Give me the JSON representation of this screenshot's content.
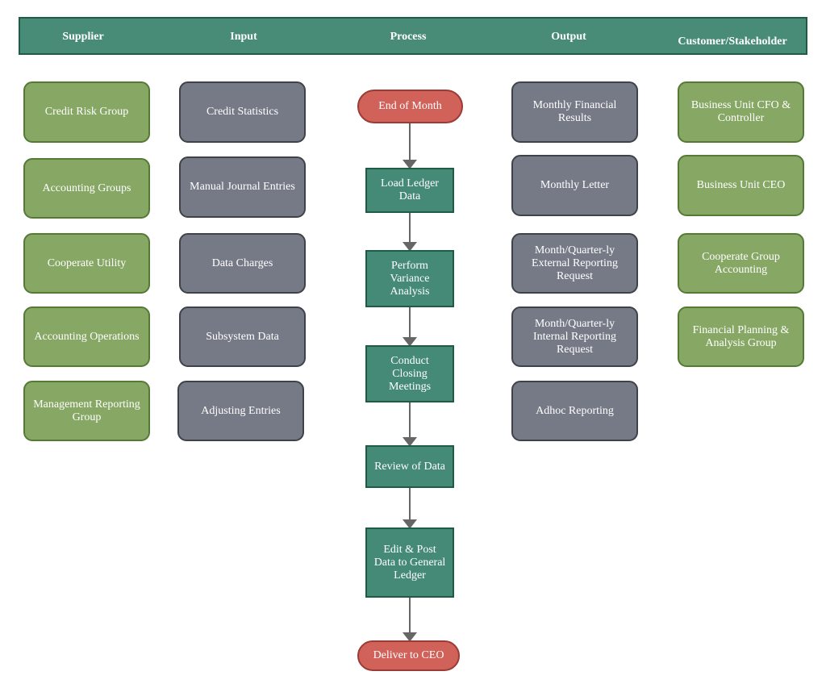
{
  "header": {
    "columns": [
      "Supplier",
      "Input",
      "Process",
      "Output",
      "Customer/Stakeholder"
    ]
  },
  "suppliers": [
    "Credit Risk Group",
    "Accounting Groups",
    "Cooperate Utility",
    "Accounting Operations",
    "Management Reporting Group"
  ],
  "inputs": [
    "Credit Statistics",
    "Manual Journal Entries",
    "Data Charges",
    "Subsystem Data",
    "Adjusting Entries"
  ],
  "process": {
    "start": "End of Month",
    "steps": [
      "Load Ledger Data",
      "Perform Variance Analysis",
      "Conduct Closing Meetings",
      "Review of Data",
      "Edit & Post Data to General Ledger"
    ],
    "end": "Deliver to CEO"
  },
  "outputs": [
    "Monthly Financial Results",
    "Monthly Letter",
    "Month/Quarter-ly External Reporting Request",
    "Month/Quarter-ly Internal Reporting Request",
    "Adhoc Reporting"
  ],
  "customers": [
    "Business Unit CFO & Controller",
    "Business Unit CEO",
    "Cooperate Group Accounting",
    "Financial Planning & Analysis Group"
  ],
  "colors": {
    "header": "#488c78",
    "supplier_customer": "#87a765",
    "input_output": "#767a86",
    "process_step": "#458a77",
    "terminal": "#d1625a",
    "connector": "#666666"
  }
}
